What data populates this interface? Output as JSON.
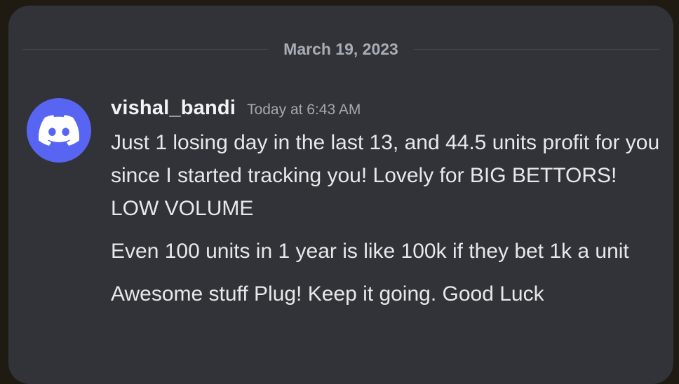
{
  "divider": {
    "date": "March 19, 2023"
  },
  "message": {
    "avatar_icon": "discord-logo-icon",
    "username": "vishal_bandi",
    "timestamp": "Today at 6:43 AM",
    "paragraphs": [
      "Just 1 losing day in the last 13, and 44.5 units profit for you since I started tracking you! Lovely for BIG BETTORS! LOW VOLUME",
      "Even 100 units in 1 year is like 100k if they bet 1k a unit",
      "Awesome stuff Plug! Keep it going. Good Luck"
    ]
  },
  "colors": {
    "background": "#313338",
    "avatar": "#5865f2",
    "username": "#f2f3f5",
    "text": "#e6e8ea",
    "muted": "#a3a7ae"
  }
}
